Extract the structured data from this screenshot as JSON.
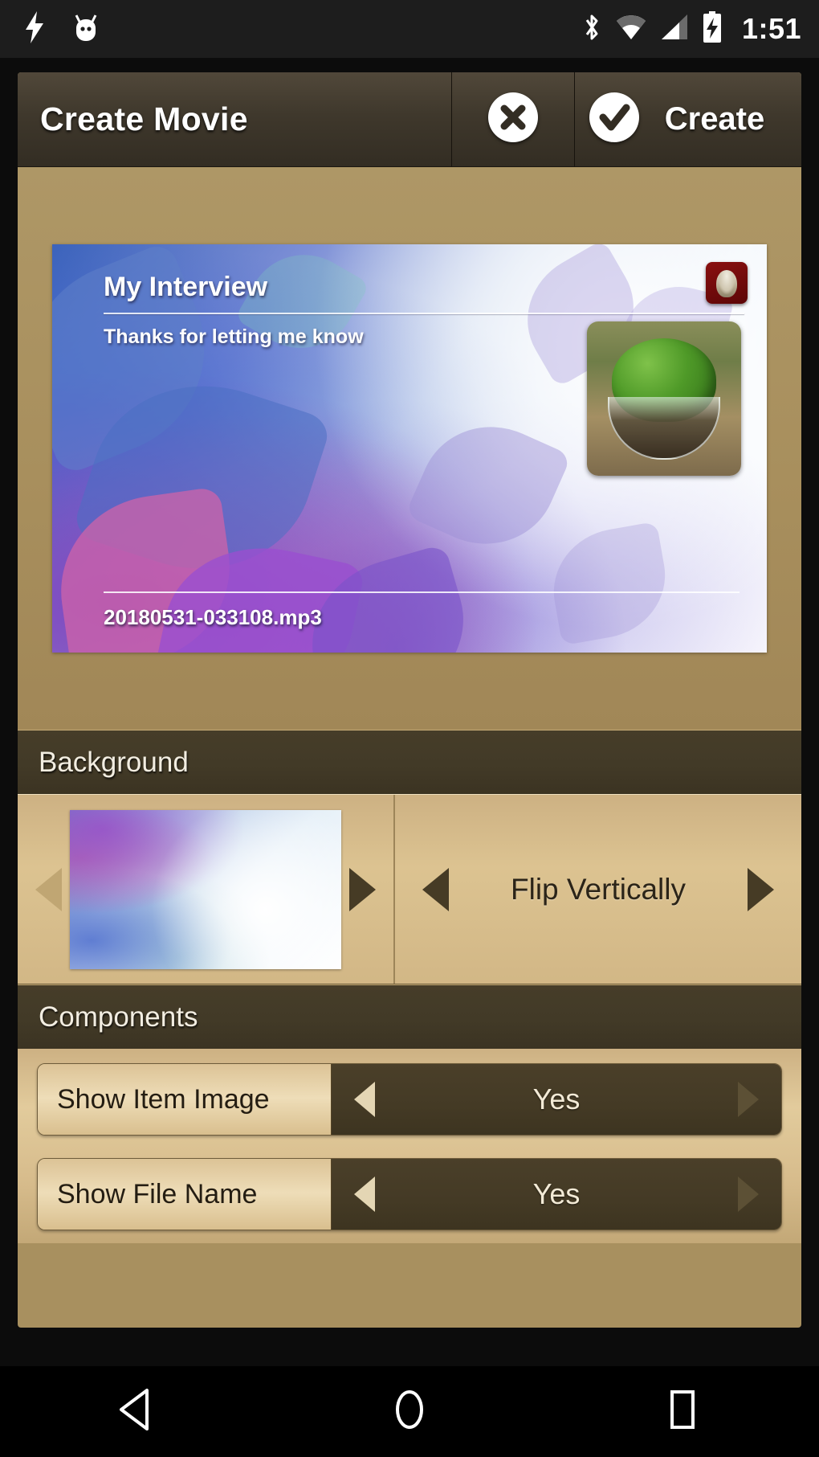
{
  "statusbar": {
    "time": "1:51",
    "left_icons": [
      "charging-bolt-icon",
      "android-head-icon"
    ],
    "right_icons": [
      "bluetooth-icon",
      "wifi-icon",
      "cellular-signal-icon",
      "battery-charging-icon"
    ]
  },
  "header": {
    "title": "Create Movie",
    "cancel_icon": "close-circle-icon",
    "create_icon": "check-circle-icon",
    "create_label": "Create"
  },
  "preview": {
    "title": "My Interview",
    "subtitle": "Thanks for letting me know",
    "file_name": "20180531-033108.mp3",
    "app_icon": "app-badge-icon",
    "item_image": "tree-terrarium-image"
  },
  "background_section": {
    "header": "Background",
    "thumbnail": "watercolor-leaves-thumbnail",
    "prev_arrow": "left-arrow-icon",
    "next_arrow": "right-arrow-icon",
    "flip": {
      "value": "Flip Vertically",
      "prev_arrow": "left-arrow-icon",
      "next_arrow": "right-arrow-icon"
    }
  },
  "components_section": {
    "header": "Components",
    "rows": [
      {
        "label": "Show Item Image",
        "value": "Yes"
      },
      {
        "label": "Show File Name",
        "value": "Yes"
      }
    ]
  },
  "navbar": {
    "back": "back-triangle-icon",
    "home": "home-circle-icon",
    "recents": "recents-square-icon"
  },
  "colors": {
    "app_background": "#a8905f",
    "panel_tan": "#dcc391",
    "panel_dark_brown": "#433a26",
    "header_brown": "#3f382c",
    "status_bar": "#1d1d1d",
    "text_light": "#f2ede1",
    "text_dark": "#241d12"
  }
}
